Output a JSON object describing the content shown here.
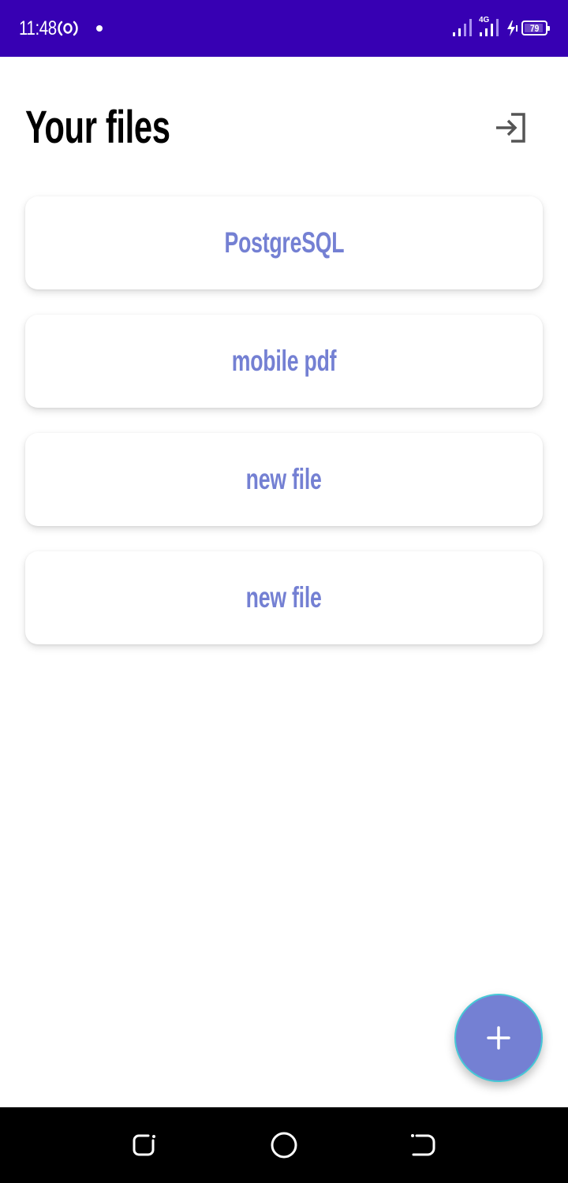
{
  "status_bar": {
    "time": "11:48",
    "battery_level": "79",
    "network_type": "4G",
    "background_color": "#3700b3",
    "icons": [
      "hotspot-icon",
      "notification-dot",
      "signal-icon",
      "signal-4g-icon",
      "charging-icon",
      "battery-icon"
    ]
  },
  "header": {
    "title": "Your files",
    "logout_icon": "login-arrow-icon"
  },
  "files": [
    {
      "label": "PostgreSQL"
    },
    {
      "label": "mobile pdf"
    },
    {
      "label": "new file"
    },
    {
      "label": "new file"
    }
  ],
  "fab": {
    "icon": "plus-icon",
    "color": "#7480d3",
    "border_color": "#46c7d6"
  },
  "nav_bar": {
    "buttons": [
      "recent-apps-icon",
      "home-icon",
      "back-icon"
    ]
  },
  "colors": {
    "accent": "#7480d3",
    "title": "#000000",
    "status_bar": "#3700b3"
  }
}
